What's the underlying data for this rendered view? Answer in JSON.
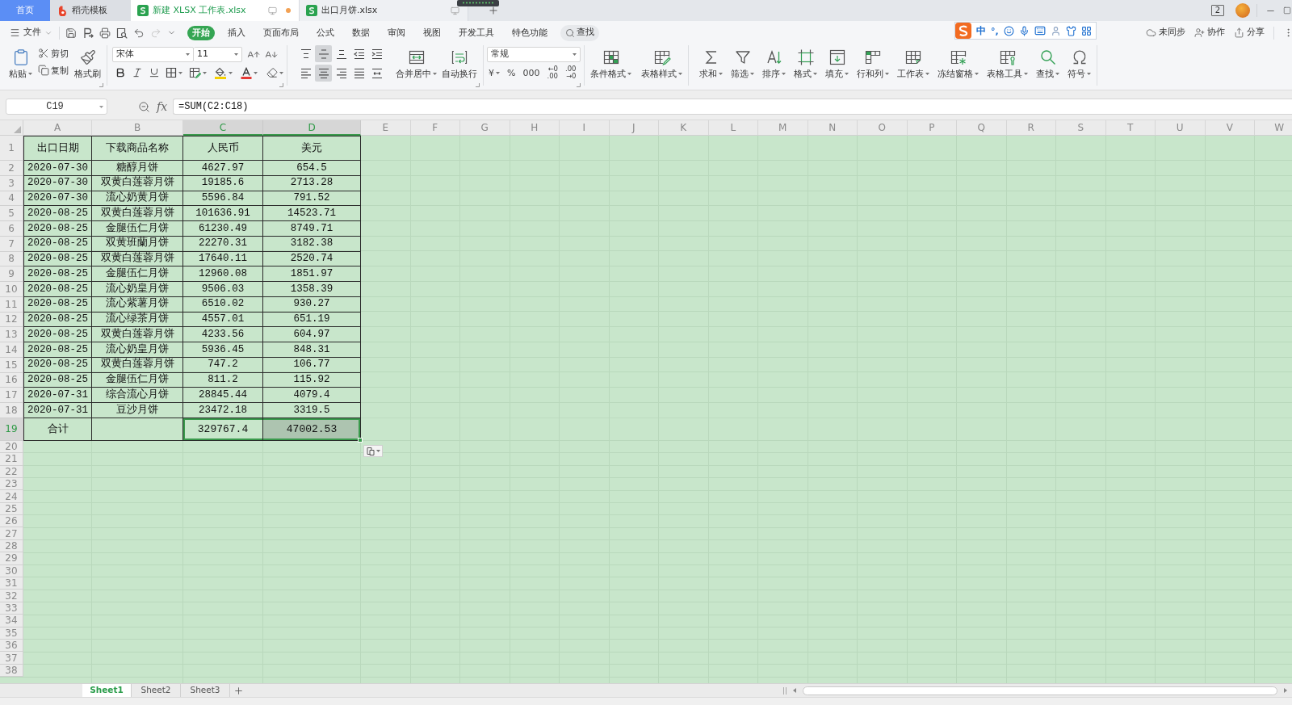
{
  "tabs": [
    {
      "kind": "home",
      "label": "首页",
      "selected": false
    },
    {
      "kind": "docer",
      "label": "稻壳模板",
      "selected": false
    },
    {
      "kind": "sheet",
      "label": "新建 XLSX 工作表.xlsx",
      "selected": true,
      "modified": true
    },
    {
      "kind": "sheet",
      "label": "出口月饼.xlsx",
      "selected": false,
      "modified": false
    }
  ],
  "title_bar": {
    "window_count": "2"
  },
  "ime": {
    "mode": "中",
    "punctuation": "°,"
  },
  "menu": {
    "file": "文件",
    "quick_access": [
      {
        "kind": "save",
        "disabled": false
      },
      {
        "kind": "export",
        "disabled": false
      },
      {
        "kind": "print",
        "disabled": false
      },
      {
        "kind": "preview",
        "disabled": false
      },
      {
        "kind": "undo",
        "disabled": false
      },
      {
        "kind": "redo",
        "disabled": true
      },
      {
        "kind": "customize",
        "disabled": false
      }
    ],
    "tabs": [
      {
        "label": "开始",
        "selected": true
      },
      {
        "label": "插入",
        "selected": false
      },
      {
        "label": "页面布局",
        "selected": false
      },
      {
        "label": "公式",
        "selected": false
      },
      {
        "label": "数据",
        "selected": false
      },
      {
        "label": "审阅",
        "selected": false
      },
      {
        "label": "视图",
        "selected": false
      },
      {
        "label": "开发工具",
        "selected": false
      },
      {
        "label": "特色功能",
        "selected": false
      }
    ],
    "search": "查找",
    "actions": [
      {
        "kind": "sync",
        "label": "未同步"
      },
      {
        "kind": "collaborate",
        "label": "协作"
      },
      {
        "kind": "share",
        "label": "分享"
      }
    ]
  },
  "ribbon": {
    "paste": {
      "label": "粘贴",
      "dropdown": true
    },
    "clip": [
      {
        "kind": "cut",
        "label": "剪切"
      },
      {
        "kind": "copy",
        "label": "复制"
      }
    ],
    "painter": "格式刷",
    "font_family": "宋体",
    "font_size": "11",
    "align_rows": [
      [
        {
          "kind": "top",
          "pressed": false
        },
        {
          "kind": "middle",
          "pressed": true
        },
        {
          "kind": "bottom",
          "pressed": false
        },
        {
          "kind": "outdent",
          "pressed": false
        },
        {
          "kind": "indent",
          "pressed": false
        }
      ],
      [
        {
          "kind": "left",
          "pressed": false
        },
        {
          "kind": "center",
          "pressed": true
        },
        {
          "kind": "right",
          "pressed": false
        },
        {
          "kind": "justify",
          "pressed": false
        },
        {
          "kind": "distribute",
          "pressed": false
        }
      ]
    ],
    "align_buttons": [
      {
        "kind": "merge",
        "label": "合并居中",
        "dropdown": true
      },
      {
        "kind": "wrap",
        "label": "自动换行",
        "dropdown": false
      }
    ],
    "number_format": "常规",
    "number_buttons": [
      {
        "kind": "single",
        "label": "¥",
        "dropdown": true
      },
      {
        "kind": "single",
        "label": "%",
        "dropdown": false
      },
      {
        "kind": "single",
        "label": "000",
        "dropdown": false
      },
      {
        "kind": "stacked",
        "top": "←0",
        "bottom": ".00",
        "dropdown": false
      },
      {
        "kind": "stacked",
        "top": ".00",
        "bottom": "→0",
        "dropdown": false
      }
    ],
    "style_buttons": [
      {
        "kind": "conditional",
        "label": "条件格式",
        "dropdown": true
      },
      {
        "kind": "table-style",
        "label": "表格样式",
        "dropdown": true
      }
    ],
    "tools": [
      {
        "kind": "sum",
        "label": "求和",
        "dropdown": true
      },
      {
        "kind": "filter",
        "label": "筛选",
        "dropdown": true
      },
      {
        "kind": "sort",
        "label": "排序",
        "dropdown": true
      },
      {
        "kind": "format",
        "label": "格式",
        "dropdown": true
      },
      {
        "kind": "fill",
        "label": "填充",
        "dropdown": true
      },
      {
        "kind": "rows-cols",
        "label": "行和列",
        "dropdown": true
      },
      {
        "kind": "sheet",
        "label": "工作表",
        "dropdown": true
      },
      {
        "kind": "freeze",
        "label": "冻结窗格",
        "dropdown": true
      },
      {
        "kind": "table-tools",
        "label": "表格工具",
        "dropdown": true
      },
      {
        "kind": "find",
        "label": "查找",
        "dropdown": true
      },
      {
        "kind": "symbol",
        "label": "符号",
        "dropdown": true
      }
    ]
  },
  "formula_bar": {
    "name_box": "C19",
    "fx": "fx",
    "formula": "=SUM(C2:C18)"
  },
  "sheet": {
    "columns": [
      {
        "label": "A",
        "selected": false
      },
      {
        "label": "B",
        "selected": false
      },
      {
        "label": "C",
        "selected": true
      },
      {
        "label": "D",
        "selected": true
      },
      {
        "label": "E",
        "selected": false
      },
      {
        "label": "F",
        "selected": false
      },
      {
        "label": "G",
        "selected": false
      },
      {
        "label": "H",
        "selected": false
      },
      {
        "label": "I",
        "selected": false
      },
      {
        "label": "J",
        "selected": false
      },
      {
        "label": "K",
        "selected": false
      },
      {
        "label": "L",
        "selected": false
      },
      {
        "label": "M",
        "selected": false
      },
      {
        "label": "N",
        "selected": false
      },
      {
        "label": "O",
        "selected": false
      },
      {
        "label": "P",
        "selected": false
      },
      {
        "label": "Q",
        "selected": false
      },
      {
        "label": "R",
        "selected": false
      },
      {
        "label": "S",
        "selected": false
      },
      {
        "label": "T",
        "selected": false
      },
      {
        "label": "U",
        "selected": false
      },
      {
        "label": "V",
        "selected": false
      },
      {
        "label": "W",
        "selected": false
      }
    ],
    "rows": [
      {
        "kind": "header",
        "label": "1",
        "selected": false,
        "cells": [
          {
            "value": "出口日期",
            "selected": false,
            "active": false
          },
          {
            "value": "下载商品名称",
            "selected": false,
            "active": false
          },
          {
            "value": "人民币",
            "selected": false,
            "active": false
          },
          {
            "value": "美元",
            "selected": false,
            "active": false
          }
        ]
      },
      {
        "kind": "data",
        "label": "2",
        "selected": false,
        "cells": [
          {
            "value": "2020-07-30",
            "selected": false,
            "active": false
          },
          {
            "value": "糖醇月饼",
            "selected": false,
            "active": false
          },
          {
            "value": "4627.97",
            "selected": false,
            "active": false
          },
          {
            "value": "654.5",
            "selected": false,
            "active": false
          }
        ]
      },
      {
        "kind": "data",
        "label": "3",
        "selected": false,
        "cells": [
          {
            "value": "2020-07-30",
            "selected": false,
            "active": false
          },
          {
            "value": "双黄白莲蓉月饼",
            "selected": false,
            "active": false
          },
          {
            "value": "19185.6",
            "selected": false,
            "active": false
          },
          {
            "value": "2713.28",
            "selected": false,
            "active": false
          }
        ]
      },
      {
        "kind": "data",
        "label": "4",
        "selected": false,
        "cells": [
          {
            "value": "2020-07-30",
            "selected": false,
            "active": false
          },
          {
            "value": "流心奶黄月饼",
            "selected": false,
            "active": false
          },
          {
            "value": "5596.84",
            "selected": false,
            "active": false
          },
          {
            "value": "791.52",
            "selected": false,
            "active": false
          }
        ]
      },
      {
        "kind": "data",
        "label": "5",
        "selected": false,
        "cells": [
          {
            "value": "2020-08-25",
            "selected": false,
            "active": false
          },
          {
            "value": "双黄白莲蓉月饼",
            "selected": false,
            "active": false
          },
          {
            "value": "101636.91",
            "selected": false,
            "active": false
          },
          {
            "value": "14523.71",
            "selected": false,
            "active": false
          }
        ]
      },
      {
        "kind": "data",
        "label": "6",
        "selected": false,
        "cells": [
          {
            "value": "2020-08-25",
            "selected": false,
            "active": false
          },
          {
            "value": "金腿伍仁月饼",
            "selected": false,
            "active": false
          },
          {
            "value": "61230.49",
            "selected": false,
            "active": false
          },
          {
            "value": "8749.71",
            "selected": false,
            "active": false
          }
        ]
      },
      {
        "kind": "data",
        "label": "7",
        "selected": false,
        "cells": [
          {
            "value": "2020-08-25",
            "selected": false,
            "active": false
          },
          {
            "value": "双黄班蘭月饼",
            "selected": false,
            "active": false
          },
          {
            "value": "22270.31",
            "selected": false,
            "active": false
          },
          {
            "value": "3182.38",
            "selected": false,
            "active": false
          }
        ]
      },
      {
        "kind": "data",
        "label": "8",
        "selected": false,
        "cells": [
          {
            "value": "2020-08-25",
            "selected": false,
            "active": false
          },
          {
            "value": "双黄白莲蓉月饼",
            "selected": false,
            "active": false
          },
          {
            "value": "17640.11",
            "selected": false,
            "active": false
          },
          {
            "value": "2520.74",
            "selected": false,
            "active": false
          }
        ]
      },
      {
        "kind": "data",
        "label": "9",
        "selected": false,
        "cells": [
          {
            "value": "2020-08-25",
            "selected": false,
            "active": false
          },
          {
            "value": "金腿伍仁月饼",
            "selected": false,
            "active": false
          },
          {
            "value": "12960.08",
            "selected": false,
            "active": false
          },
          {
            "value": "1851.97",
            "selected": false,
            "active": false
          }
        ]
      },
      {
        "kind": "data",
        "label": "10",
        "selected": false,
        "cells": [
          {
            "value": "2020-08-25",
            "selected": false,
            "active": false
          },
          {
            "value": "流心奶皇月饼",
            "selected": false,
            "active": false
          },
          {
            "value": "9506.03",
            "selected": false,
            "active": false
          },
          {
            "value": "1358.39",
            "selected": false,
            "active": false
          }
        ]
      },
      {
        "kind": "data",
        "label": "11",
        "selected": false,
        "cells": [
          {
            "value": "2020-08-25",
            "selected": false,
            "active": false
          },
          {
            "value": "流心紫薯月饼",
            "selected": false,
            "active": false
          },
          {
            "value": "6510.02",
            "selected": false,
            "active": false
          },
          {
            "value": "930.27",
            "selected": false,
            "active": false
          }
        ]
      },
      {
        "kind": "data",
        "label": "12",
        "selected": false,
        "cells": [
          {
            "value": "2020-08-25",
            "selected": false,
            "active": false
          },
          {
            "value": "流心绿茶月饼",
            "selected": false,
            "active": false
          },
          {
            "value": "4557.01",
            "selected": false,
            "active": false
          },
          {
            "value": "651.19",
            "selected": false,
            "active": false
          }
        ]
      },
      {
        "kind": "data",
        "label": "13",
        "selected": false,
        "cells": [
          {
            "value": "2020-08-25",
            "selected": false,
            "active": false
          },
          {
            "value": "双黄白莲蓉月饼",
            "selected": false,
            "active": false
          },
          {
            "value": "4233.56",
            "selected": false,
            "active": false
          },
          {
            "value": "604.97",
            "selected": false,
            "active": false
          }
        ]
      },
      {
        "kind": "data",
        "label": "14",
        "selected": false,
        "cells": [
          {
            "value": "2020-08-25",
            "selected": false,
            "active": false
          },
          {
            "value": "流心奶皇月饼",
            "selected": false,
            "active": false
          },
          {
            "value": "5936.45",
            "selected": false,
            "active": false
          },
          {
            "value": "848.31",
            "selected": false,
            "active": false
          }
        ]
      },
      {
        "kind": "data",
        "label": "15",
        "selected": false,
        "cells": [
          {
            "value": "2020-08-25",
            "selected": false,
            "active": false
          },
          {
            "value": "双黄白莲蓉月饼",
            "selected": false,
            "active": false
          },
          {
            "value": "747.2",
            "selected": false,
            "active": false
          },
          {
            "value": "106.77",
            "selected": false,
            "active": false
          }
        ]
      },
      {
        "kind": "data",
        "label": "16",
        "selected": false,
        "cells": [
          {
            "value": "2020-08-25",
            "selected": false,
            "active": false
          },
          {
            "value": "金腿伍仁月饼",
            "selected": false,
            "active": false
          },
          {
            "value": "811.2",
            "selected": false,
            "active": false
          },
          {
            "value": "115.92",
            "selected": false,
            "active": false
          }
        ]
      },
      {
        "kind": "data",
        "label": "17",
        "selected": false,
        "cells": [
          {
            "value": "2020-07-31",
            "selected": false,
            "active": false
          },
          {
            "value": "综合流心月饼",
            "selected": false,
            "active": false
          },
          {
            "value": "28845.44",
            "selected": false,
            "active": false
          },
          {
            "value": "4079.4",
            "selected": false,
            "active": false
          }
        ]
      },
      {
        "kind": "data",
        "label": "18",
        "selected": false,
        "cells": [
          {
            "value": "2020-07-31",
            "selected": false,
            "active": false
          },
          {
            "value": "豆沙月饼",
            "selected": false,
            "active": false
          },
          {
            "value": "23472.18",
            "selected": false,
            "active": false
          },
          {
            "value": "3319.5",
            "selected": false,
            "active": false
          }
        ]
      },
      {
        "kind": "total",
        "label": "19",
        "selected": true,
        "cells": [
          {
            "value": "合计",
            "selected": false,
            "active": false
          },
          {
            "selected": false,
            "active": false
          },
          {
            "value": "329767.4",
            "selected": true,
            "active": true
          },
          {
            "value": "47002.53",
            "selected": true,
            "active": false
          }
        ]
      },
      {
        "kind": "empty",
        "label": "20",
        "selected": false
      },
      {
        "kind": "empty",
        "label": "21",
        "selected": false
      },
      {
        "kind": "empty",
        "label": "22",
        "selected": false
      },
      {
        "kind": "empty",
        "label": "23",
        "selected": false
      },
      {
        "kind": "empty",
        "label": "24",
        "selected": false
      },
      {
        "kind": "empty",
        "label": "25",
        "selected": false
      },
      {
        "kind": "empty",
        "label": "26",
        "selected": false
      },
      {
        "kind": "empty",
        "label": "27",
        "selected": false
      },
      {
        "kind": "empty",
        "label": "28",
        "selected": false
      },
      {
        "kind": "empty",
        "label": "29",
        "selected": false
      },
      {
        "kind": "empty",
        "label": "30",
        "selected": false
      },
      {
        "kind": "empty",
        "label": "31",
        "selected": false
      },
      {
        "kind": "empty",
        "label": "32",
        "selected": false
      },
      {
        "kind": "empty",
        "label": "33",
        "selected": false
      },
      {
        "kind": "empty",
        "label": "34",
        "selected": false
      },
      {
        "kind": "empty",
        "label": "35",
        "selected": false
      },
      {
        "kind": "empty",
        "label": "36",
        "selected": false
      },
      {
        "kind": "empty",
        "label": "37",
        "selected": false
      },
      {
        "kind": "empty",
        "label": "38",
        "selected": false
      }
    ]
  },
  "sheet_tabs": [
    {
      "label": "Sheet1",
      "selected": true
    },
    {
      "label": "Sheet2",
      "selected": false
    },
    {
      "label": "Sheet3",
      "selected": false
    }
  ]
}
